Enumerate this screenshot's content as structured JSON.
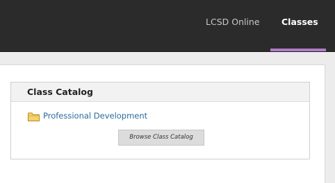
{
  "nav": {
    "items": [
      {
        "label": "LCSD Online"
      },
      {
        "label": "Classes"
      }
    ],
    "active_color": "#b07cc6"
  },
  "module": {
    "title": "Class Catalog",
    "items": [
      {
        "label": "Professional Development",
        "icon": "folder-icon"
      }
    ],
    "browse_button_label": "Browse Class Catalog"
  }
}
